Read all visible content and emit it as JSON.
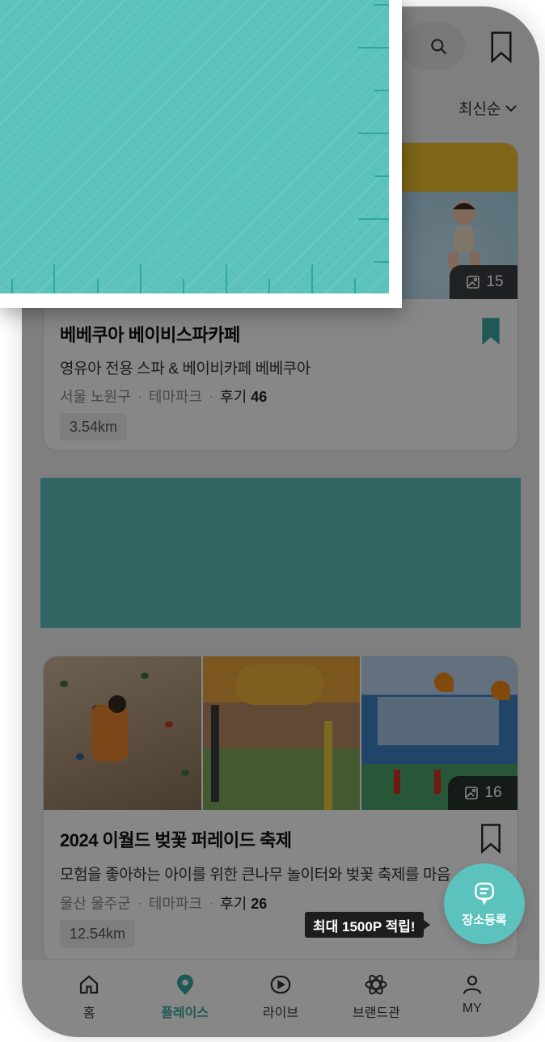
{
  "header": {
    "search_icon": "search-icon",
    "bookmark_icon": "bookmark-icon",
    "sort_label": "최신순"
  },
  "cards": [
    {
      "title": "베베쿠아 베이비스파카페",
      "description": "영유아 전용 스파 & 베이비카페 베베쿠아",
      "region": "서울 노원구",
      "category": "테마파크",
      "review_label": "후기",
      "review_count": "46",
      "distance": "3.54km",
      "photo_count": "15",
      "bookmarked": true
    },
    {
      "title": "2024 이월드 벚꽃 퍼레이드 축제",
      "description": "모험을 좋아하는 아이를 위한 큰나무 놀이터와 벚꽃 축제를 마음",
      "region": "울산 울주군",
      "category": "테마파크",
      "review_label": "후기",
      "review_count": "26",
      "distance": "12.54km",
      "photo_count": "16",
      "bookmarked": false
    }
  ],
  "fab": {
    "label": "장소등록",
    "promo": "최대 1500P 적립!"
  },
  "bottom_nav": [
    {
      "label": "홈",
      "icon": "home-icon",
      "active": false
    },
    {
      "label": "플레이스",
      "icon": "location-pin-icon",
      "active": true
    },
    {
      "label": "라이브",
      "icon": "play-icon",
      "active": false
    },
    {
      "label": "브랜드관",
      "icon": "atom-icon",
      "active": false
    },
    {
      "label": "MY",
      "icon": "person-icon",
      "active": false
    }
  ],
  "colors": {
    "accent": "#5bc2bd",
    "accent_dark": "#3aa9a3",
    "banner": "#5bc2bd"
  }
}
